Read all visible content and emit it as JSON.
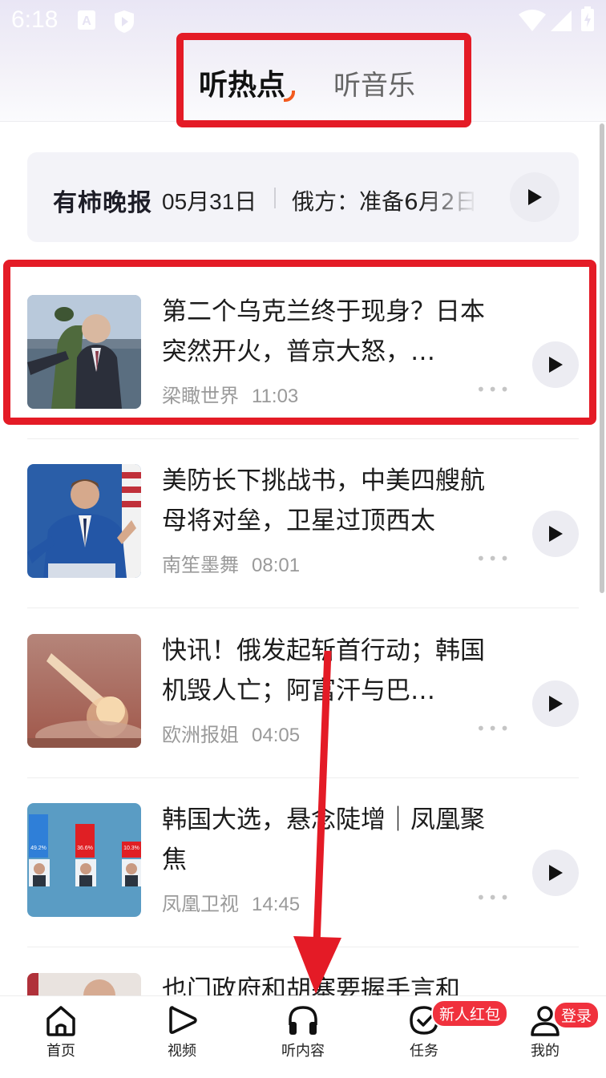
{
  "status_bar": {
    "time": "6:18"
  },
  "header": {
    "tabs": [
      {
        "label": "听热点",
        "active": true
      },
      {
        "label": "听音乐",
        "active": false
      }
    ]
  },
  "daily": {
    "brand": "有柿晚报",
    "date": "05月31日",
    "headline": "俄方：准备6月2日"
  },
  "news": [
    {
      "title": "第二个乌克兰终于现身？日本突然开火，普京大怒，…",
      "source": "梁瞰世界",
      "time": "11:03"
    },
    {
      "title": "美防长下挑战书，中美四艘航母将对垒，卫星过顶西太",
      "source": "南笙墨舞",
      "time": "08:01"
    },
    {
      "title": "快讯！俄发起斩首行动；韩国机毁人亡；阿富汗与巴…",
      "source": "欧洲报姐",
      "time": "04:05"
    },
    {
      "title": "韩国大选，悬念陡增｜凤凰聚焦",
      "source": "凤凰卫视",
      "time": "14:45"
    },
    {
      "title": "也门政府和胡塞要握手言和"
    }
  ],
  "thumb4_bars": [
    "49.2%",
    "36.6%",
    "10.3%"
  ],
  "nav": {
    "items": [
      {
        "label": "首页"
      },
      {
        "label": "视频"
      },
      {
        "label": "听内容"
      },
      {
        "label": "任务",
        "badge": "新人红包"
      },
      {
        "label": "我的",
        "badge": "登录"
      }
    ]
  },
  "colors": {
    "accent": "#f25a1f",
    "annotation": "#e41b26",
    "badge": "#f0313d"
  }
}
